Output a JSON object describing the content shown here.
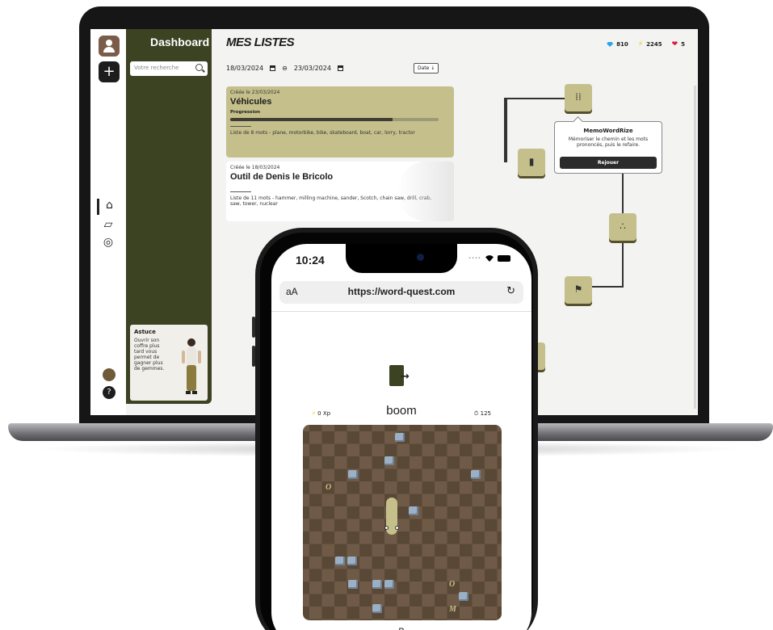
{
  "laptop": {
    "sidebar": {
      "title": "Dashboard",
      "search_placeholder": "Votre recherche"
    },
    "tip": {
      "title": "Astuce",
      "text": "Ouvrir son coffre plus tard vous permet de gagner plus de gemmes."
    },
    "main": {
      "title": "MES LISTES",
      "stats": {
        "gems": "810",
        "xp": "2245",
        "lives": "5"
      },
      "date_from": "18/03/2024",
      "date_to": "23/03/2024",
      "sort_label": "Date ↓",
      "lists": [
        {
          "date": "Créée le 23/03/2024",
          "name": "Véhicules",
          "progress_label": "Progression",
          "progress": 0.78,
          "description": "Liste de 8 mots - plane, motorbike, bike, skateboard, boat, car, lorry, tractor"
        },
        {
          "date": "Créée le 18/03/2024",
          "name": "Outil de Denis le Bricolo",
          "description": "Liste de 11 mots - hammer, milling machine, sander, Scotch, chain saw, drill, crab, saw, tower, nuclear"
        }
      ]
    },
    "popup": {
      "title": "MemoWordRize",
      "description": "Mémoriser le chemin et les mots prononcés, puis le refaire.",
      "button": "Rejouer"
    }
  },
  "phone": {
    "time": "10:24",
    "url_aa": "aA",
    "url": "https://word-quest.com",
    "xp": "0 Xp",
    "word": "boom",
    "timer": "125",
    "letter": "B"
  },
  "colors": {
    "olive": "#3b4322",
    "khaki": "#c5c08b",
    "board": "#6e5a47"
  }
}
